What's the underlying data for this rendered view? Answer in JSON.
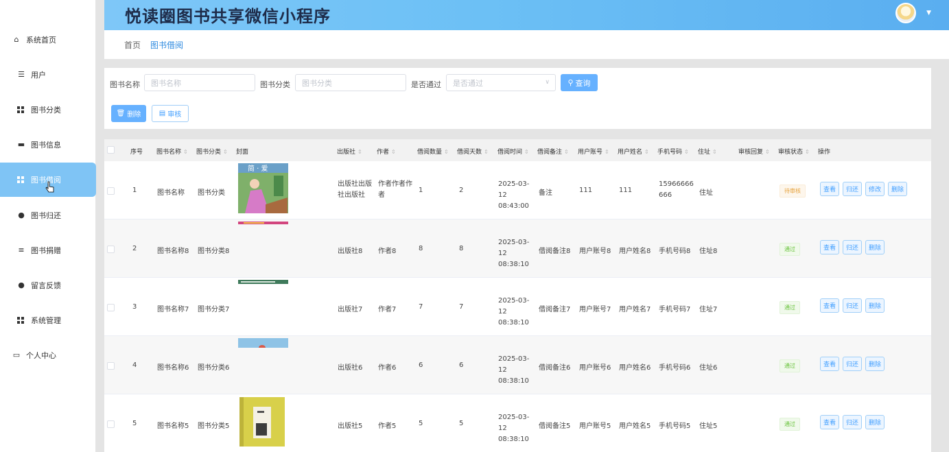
{
  "app": {
    "title": "悦读圈图书共享微信小程序"
  },
  "sidebar": {
    "items": [
      {
        "label": "系统首页",
        "icon": "home-icon"
      },
      {
        "label": "用户",
        "icon": "sliders-icon"
      },
      {
        "label": "图书分类",
        "icon": "grid-icon"
      },
      {
        "label": "图书信息",
        "icon": "monitor-icon"
      },
      {
        "label": "图书借阅",
        "icon": "grid-icon",
        "active": true
      },
      {
        "label": "图书归还",
        "icon": "user-icon"
      },
      {
        "label": "图书捐赠",
        "icon": "list-icon"
      },
      {
        "label": "留言反馈",
        "icon": "location-pin-icon"
      },
      {
        "label": "系统管理",
        "icon": "grid-icon"
      },
      {
        "label": "个人中心",
        "icon": "card-icon"
      }
    ]
  },
  "breadcrumb": {
    "home": "首页",
    "current": "图书借阅"
  },
  "search": {
    "name_label": "图书名称",
    "name_placeholder": "图书名称",
    "category_label": "图书分类",
    "category_placeholder": "图书分类",
    "approved_label": "是否通过",
    "approved_placeholder": "是否通过",
    "query_label": "查询"
  },
  "actions": {
    "delete_label": "删除",
    "audit_label": "审核"
  },
  "table": {
    "headers": {
      "index": "序号",
      "name": "图书名称",
      "category": "图书分类",
      "cover": "封面",
      "publisher": "出版社",
      "author": "作者",
      "qty": "借阅数量",
      "days": "借阅天数",
      "time": "借阅时间",
      "remark": "借阅备注",
      "account": "用户账号",
      "username": "用户姓名",
      "phone": "手机号码",
      "address": "住址",
      "reply": "审核回复",
      "status": "审核状态",
      "ops": "操作"
    },
    "rows": [
      {
        "index": "1",
        "name": "图书名称",
        "category": "图书分类",
        "publisher": "出版社出版社出版社",
        "author": "作者作者作者",
        "qty": "1",
        "days": "2",
        "time": "2025-03-12 08:43:00",
        "remark": "备注",
        "account": "111",
        "username": "111",
        "phone": "15966666666",
        "address": "住址",
        "status": "待审核",
        "status_type": "pending",
        "ops": [
          "查看",
          "归还",
          "修改",
          "删除"
        ]
      },
      {
        "index": "2",
        "name": "图书名称8",
        "category": "图书分类8",
        "publisher": "出版社8",
        "author": "作者8",
        "qty": "8",
        "days": "8",
        "time": "2025-03-12 08:38:10",
        "remark": "借阅备注8",
        "account": "用户账号8",
        "username": "用户姓名8",
        "phone": "手机号码8",
        "address": "住址8",
        "status": "通过",
        "status_type": "pass",
        "ops": [
          "查看",
          "归还",
          "删除"
        ]
      },
      {
        "index": "3",
        "name": "图书名称7",
        "category": "图书分类7",
        "publisher": "出版社7",
        "author": "作者7",
        "qty": "7",
        "days": "7",
        "time": "2025-03-12 08:38:10",
        "remark": "借阅备注7",
        "account": "用户账号7",
        "username": "用户姓名7",
        "phone": "手机号码7",
        "address": "住址7",
        "status": "通过",
        "status_type": "pass",
        "ops": [
          "查看",
          "归还",
          "删除"
        ]
      },
      {
        "index": "4",
        "name": "图书名称6",
        "category": "图书分类6",
        "publisher": "出版社6",
        "author": "作者6",
        "qty": "6",
        "days": "6",
        "time": "2025-03-12 08:38:10",
        "remark": "借阅备注6",
        "account": "用户账号6",
        "username": "用户姓名6",
        "phone": "手机号码6",
        "address": "住址6",
        "status": "通过",
        "status_type": "pass",
        "ops": [
          "查看",
          "归还",
          "删除"
        ]
      },
      {
        "index": "5",
        "name": "图书名称5",
        "category": "图书分类5",
        "publisher": "出版社5",
        "author": "作者5",
        "qty": "5",
        "days": "5",
        "time": "2025-03-12 08:38:10",
        "remark": "借阅备注5",
        "account": "用户账号5",
        "username": "用户姓名5",
        "phone": "手机号码5",
        "address": "住址5",
        "status": "通过",
        "status_type": "pass",
        "ops": [
          "查看",
          "归还",
          "删除"
        ]
      }
    ]
  },
  "colors": {
    "primary": "#409eff",
    "header_start": "#7ec7f8",
    "header_end": "#5aaef0",
    "active_menu": "#7fc4f5",
    "pending": "#e6a23c",
    "pass": "#67c23a"
  }
}
